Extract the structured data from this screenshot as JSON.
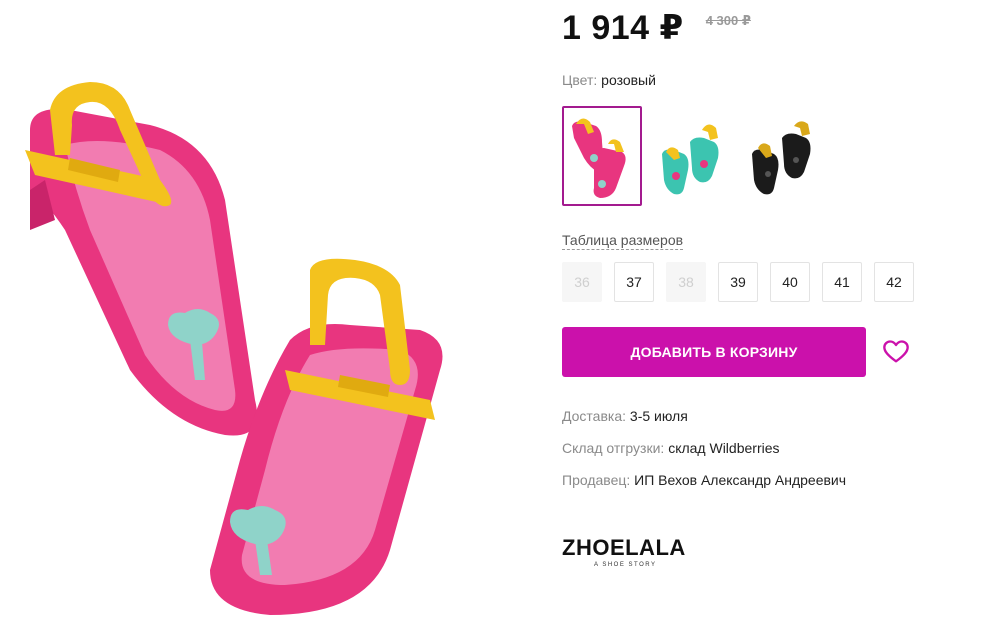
{
  "price": {
    "current": "1 914 ₽",
    "old": "4 300 ₽"
  },
  "color": {
    "label": "Цвет:",
    "value": "розовый",
    "swatches": [
      {
        "name": "pink",
        "selected": true
      },
      {
        "name": "mint",
        "selected": false
      },
      {
        "name": "black",
        "selected": false
      }
    ]
  },
  "sizes": {
    "table_label": "Таблица размеров",
    "items": [
      {
        "label": "36",
        "available": false
      },
      {
        "label": "37",
        "available": true
      },
      {
        "label": "38",
        "available": false
      },
      {
        "label": "39",
        "available": true
      },
      {
        "label": "40",
        "available": true
      },
      {
        "label": "41",
        "available": true
      },
      {
        "label": "42",
        "available": true
      }
    ]
  },
  "cart": {
    "add_label": "ДОБАВИТЬ В КОРЗИНУ"
  },
  "delivery": {
    "label": "Доставка:",
    "value": "3-5 июля"
  },
  "warehouse": {
    "label": "Склад отгрузки:",
    "value": "склад Wildberries"
  },
  "seller": {
    "label": "Продавец:",
    "value": "ИП Вехов Александр Андреевич"
  },
  "brand": {
    "name": "ZHOELALA",
    "tagline": "A SHOE STORY"
  },
  "colors": {
    "accent": "#cb11ab",
    "selected_border": "#a31a8f",
    "sandal_pink": "#e8357f",
    "sandal_yellow": "#f3c21e",
    "heart_mint": "#8fd3c9"
  },
  "icons": {
    "wishlist": "heart-outline-icon"
  }
}
